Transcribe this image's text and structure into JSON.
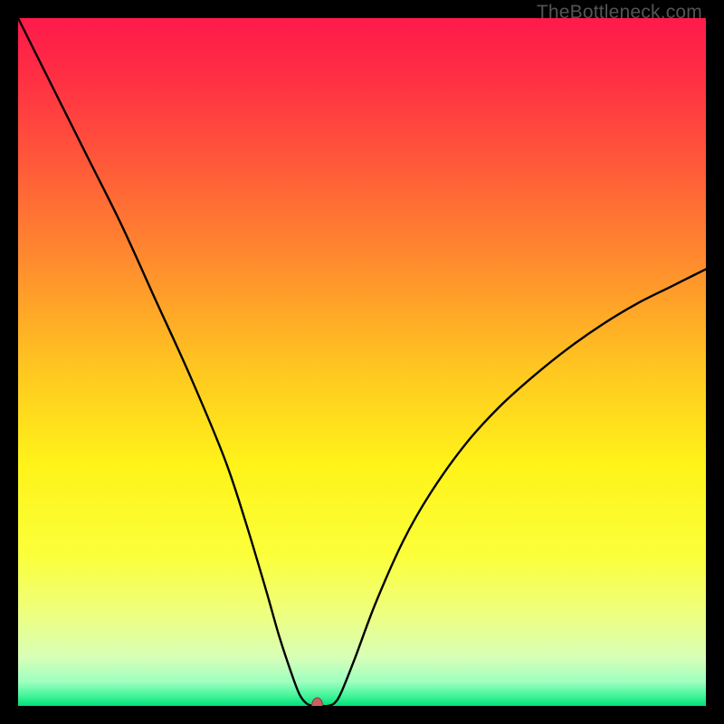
{
  "watermark": "TheBottleneck.com",
  "chart_data": {
    "type": "line",
    "title": "",
    "xlabel": "",
    "ylabel": "",
    "xlim": [
      0,
      100
    ],
    "ylim": [
      0,
      100
    ],
    "marker": {
      "x": 43.5,
      "y": 0,
      "color": "#c86262",
      "rx": 6,
      "ry": 9
    },
    "curve": [
      {
        "x": 0,
        "y": 100
      },
      {
        "x": 5,
        "y": 90
      },
      {
        "x": 10,
        "y": 80
      },
      {
        "x": 15,
        "y": 70
      },
      {
        "x": 20,
        "y": 59
      },
      {
        "x": 25,
        "y": 48
      },
      {
        "x": 30,
        "y": 36
      },
      {
        "x": 33,
        "y": 27
      },
      {
        "x": 36,
        "y": 17
      },
      {
        "x": 38,
        "y": 10
      },
      {
        "x": 40,
        "y": 4
      },
      {
        "x": 41,
        "y": 1.5
      },
      {
        "x": 42,
        "y": 0.3
      },
      {
        "x": 43,
        "y": 0
      },
      {
        "x": 44,
        "y": 0
      },
      {
        "x": 45,
        "y": 0
      },
      {
        "x": 46,
        "y": 0.4
      },
      {
        "x": 47,
        "y": 2
      },
      {
        "x": 49,
        "y": 7
      },
      {
        "x": 52,
        "y": 15
      },
      {
        "x": 56,
        "y": 24
      },
      {
        "x": 60,
        "y": 31
      },
      {
        "x": 65,
        "y": 38
      },
      {
        "x": 70,
        "y": 43.5
      },
      {
        "x": 75,
        "y": 48
      },
      {
        "x": 80,
        "y": 52
      },
      {
        "x": 85,
        "y": 55.5
      },
      {
        "x": 90,
        "y": 58.5
      },
      {
        "x": 95,
        "y": 61
      },
      {
        "x": 100,
        "y": 63.5
      }
    ],
    "gradient_stops": [
      {
        "offset": 0,
        "color": "#ff1a4a"
      },
      {
        "offset": 0.08,
        "color": "#ff2d44"
      },
      {
        "offset": 0.2,
        "color": "#ff553a"
      },
      {
        "offset": 0.35,
        "color": "#ff8a2e"
      },
      {
        "offset": 0.5,
        "color": "#ffc321"
      },
      {
        "offset": 0.65,
        "color": "#fff319"
      },
      {
        "offset": 0.78,
        "color": "#fbff3a"
      },
      {
        "offset": 0.87,
        "color": "#edff82"
      },
      {
        "offset": 0.93,
        "color": "#d7ffb8"
      },
      {
        "offset": 0.965,
        "color": "#9effc0"
      },
      {
        "offset": 0.985,
        "color": "#44f59a"
      },
      {
        "offset": 1.0,
        "color": "#00e07a"
      }
    ]
  }
}
